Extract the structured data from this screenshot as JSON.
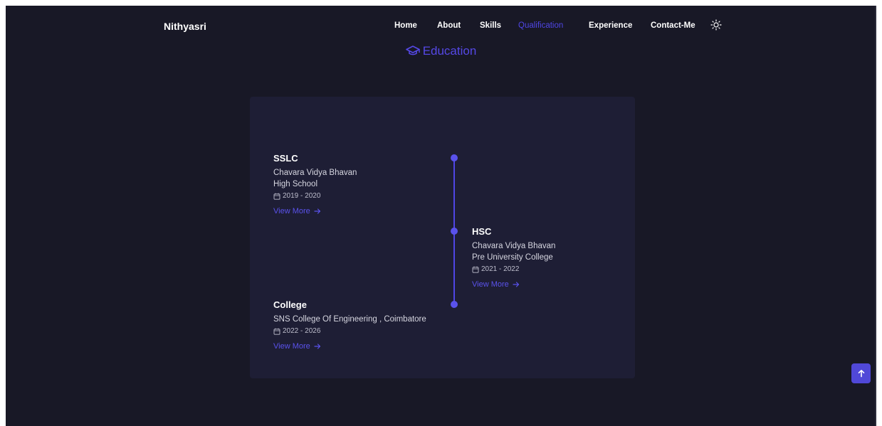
{
  "brand": "Nithyasri",
  "nav": {
    "items": [
      {
        "label": "Home"
      },
      {
        "label": "About"
      },
      {
        "label": "Skills"
      },
      {
        "label": "Qualification"
      },
      {
        "label": "Experience"
      },
      {
        "label": "Contact-Me"
      }
    ],
    "active": "Qualification",
    "theme_icon": "sun-icon"
  },
  "section": {
    "title": "Education",
    "icon": "graduation-cap-icon"
  },
  "timeline": [
    {
      "title": "SSLC",
      "lines": [
        "Chavara Vidya Bhavan",
        "High School"
      ],
      "date": "2019 - 2020",
      "link": "View More"
    },
    {
      "title": "HSC",
      "lines": [
        "Chavara Vidya Bhavan",
        "Pre University College"
      ],
      "date": "2021 - 2022",
      "link": "View More"
    },
    {
      "title": "College",
      "lines": [
        "SNS College Of Engineering , Coimbatore"
      ],
      "date": "2022 - 2026",
      "link": "View More"
    }
  ],
  "scroll_top": {
    "icon": "arrow-up-icon"
  },
  "colors": {
    "background": "#181826",
    "card": "#1e1e35",
    "accent": "#4f46e5",
    "text": "#ffffff"
  }
}
